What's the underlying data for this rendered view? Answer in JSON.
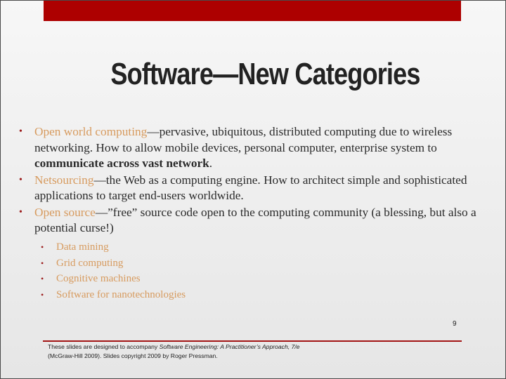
{
  "slide": {
    "title": "Software—New Categories",
    "bullets": [
      {
        "term": "Open world computing",
        "rest_a": "—pervasive, ubiquitous, distributed computing due to wireless networking. How to allow mobile devices, personal computer, enterprise system to ",
        "bold": "communicate across vast network",
        "rest_b": "."
      },
      {
        "term": "Netsourcing",
        "rest_a": "—the Web as a computing engine. How to architect simple and sophisticated applications to target end-users worldwide."
      },
      {
        "term": "Open source",
        "rest_a": "—”free” source code open to the computing community (a blessing, but also a potential curse!)"
      }
    ],
    "sub_bullets": [
      "Data mining",
      "Grid computing",
      "Cognitive machines",
      "Software for nanotechnologies"
    ],
    "bullet_glyph": "•",
    "page_number": "9",
    "footer": {
      "part1": "These slides are designed to accompany ",
      "book_title": "Software Engineering: A Practitioner’s Approach, 7/e",
      "part2": " (McGraw-Hill 2009). Slides copyright 2009 by Roger Pressman."
    },
    "colors": {
      "banner": "#ad0000",
      "accent": "#d79b5f",
      "bullet": "#9b1b1b",
      "rule": "#a31515"
    }
  }
}
